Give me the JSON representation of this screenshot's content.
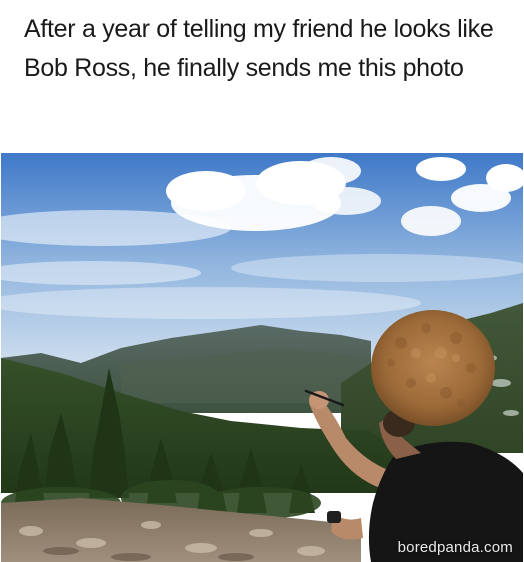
{
  "caption": {
    "text": "After a year of telling my friend he looks like Bob Ross, he finally sends me this photo"
  },
  "photo": {
    "description_icon": "mountain-landscape-photo",
    "watermark": "boredpanda.com"
  },
  "colors": {
    "sky_top": "#3f79c8",
    "sky_bottom": "#d8e6f2",
    "mountain": "#4a5a52",
    "forest": "#2f4a22",
    "hair": "#a0703e",
    "shirt": "#151515"
  }
}
